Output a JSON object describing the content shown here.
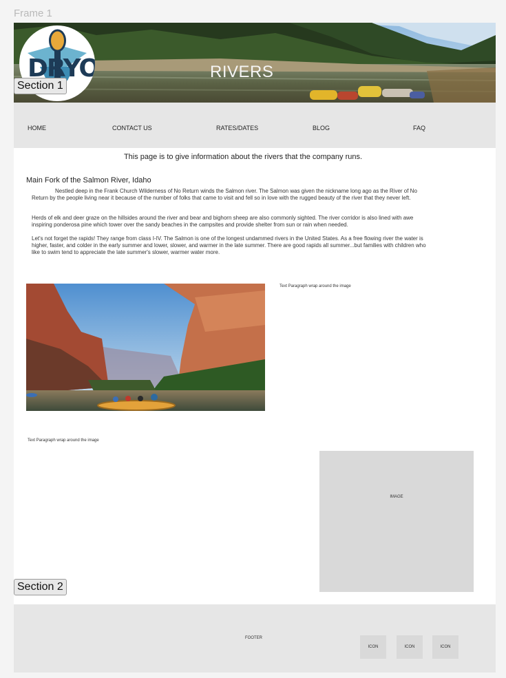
{
  "frame": {
    "label": "Frame 1"
  },
  "header": {
    "title": "RIVERS",
    "logo_text": "DRYOAR"
  },
  "sections": {
    "section1": "Section 1",
    "section2": "Section 2"
  },
  "nav": {
    "items": [
      "HOME",
      "CONTACT US",
      "RATES/DATES",
      "BLOG",
      "FAQ"
    ]
  },
  "main": {
    "intro": "This page is to give information about the rivers that the company runs.",
    "heading": "Main Fork of the Salmon River, Idaho",
    "paragraphs": [
      "Nestled deep in the Frank Church Wilderness of No Return winds the Salmon river. The Salmon was given the nickname long ago as the River of No Return by the people living near it because of the number of folks that came to visit and fell so in love with the rugged beauty of the river that they never left.",
      "Herds of elk and deer graze on the hillsides around the river and bear and bighorn sheep are also commonly sighted. The river corridor is also lined with awe inspiring ponderosa pine which tower over the sandy beaches in the campsites and provide shelter from sun or rain when needed.",
      "Let's not forget the rapids! They range from class I-IV. The Salmon is one of the longest undammed rivers in the United States. As a free flowing river the water is higher, faster, and colder in the early summer and lower, slower, and warmer in the late summer. There are good rapids all summer...but families with children who like to swim tend to appreciate the late summer's slower, warmer water more."
    ],
    "text_wrap_1": "Text Paragraph  wrap around the image",
    "text_wrap_2": "Text Paragraph  wrap around the image",
    "image_placeholder": "IMAGE"
  },
  "footer": {
    "label": "FOOTER",
    "icons": [
      "ICON",
      "ICON",
      "ICON"
    ]
  }
}
